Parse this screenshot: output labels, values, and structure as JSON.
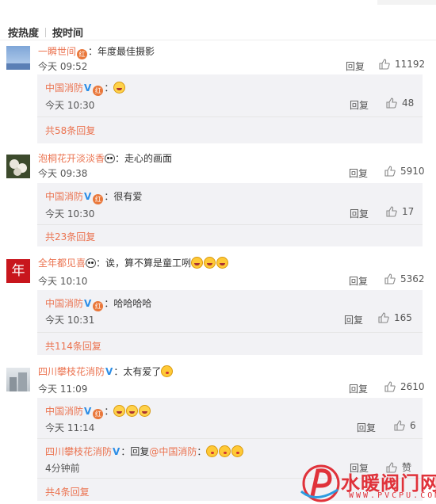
{
  "sort": {
    "hot": "按热度",
    "time": "按时间"
  },
  "labels": {
    "reply": "回复",
    "like_partial": "赞"
  },
  "colors": {
    "username": "#eb7350",
    "verified": "#2b8de6",
    "bg_sub": "#f2f2f5",
    "watermark": "#e0323a"
  },
  "comments": [
    {
      "user": "一瞬世间",
      "text": "：年度最佳摄影",
      "time": "今天 09:52",
      "likes": "11192",
      "reply": {
        "user": "中国消防",
        "text": "：",
        "time": "今天 10:30",
        "likes": "48"
      },
      "more": "共58条回复"
    },
    {
      "user": "泡桐花开淡淡香",
      "text": "：走心的画面",
      "time": "今天 09:38",
      "likes": "5910",
      "reply": {
        "user": "中国消防",
        "text": "：很有爱",
        "time": "今天 10:30",
        "likes": "17"
      },
      "more": "共23条回复"
    },
    {
      "user": "全年都见喜",
      "text": "：诶，算不算是童工咧",
      "avatar_char": "年",
      "time": "今天 10:10",
      "likes": "5362",
      "reply": {
        "user": "中国消防",
        "text": "：哈哈哈哈",
        "time": "今天 10:31",
        "likes": "165"
      },
      "more": "共114条回复"
    },
    {
      "user": "四川攀枝花消防",
      "text": "：太有爱了",
      "time": "今天 11:09",
      "likes": "2610",
      "reply": {
        "user": "中国消防",
        "text": "：",
        "time": "今天 11:14",
        "likes": "6"
      },
      "reply2": {
        "user": "四川攀枝花消防",
        "text": "：回复",
        "mention": "@中国消防",
        "colon": "：",
        "time": "4分钟前"
      },
      "more": "共4条回复"
    }
  ],
  "watermark": {
    "text": "水暖阀门网",
    "url": "WWW.PVCPU.COM"
  }
}
